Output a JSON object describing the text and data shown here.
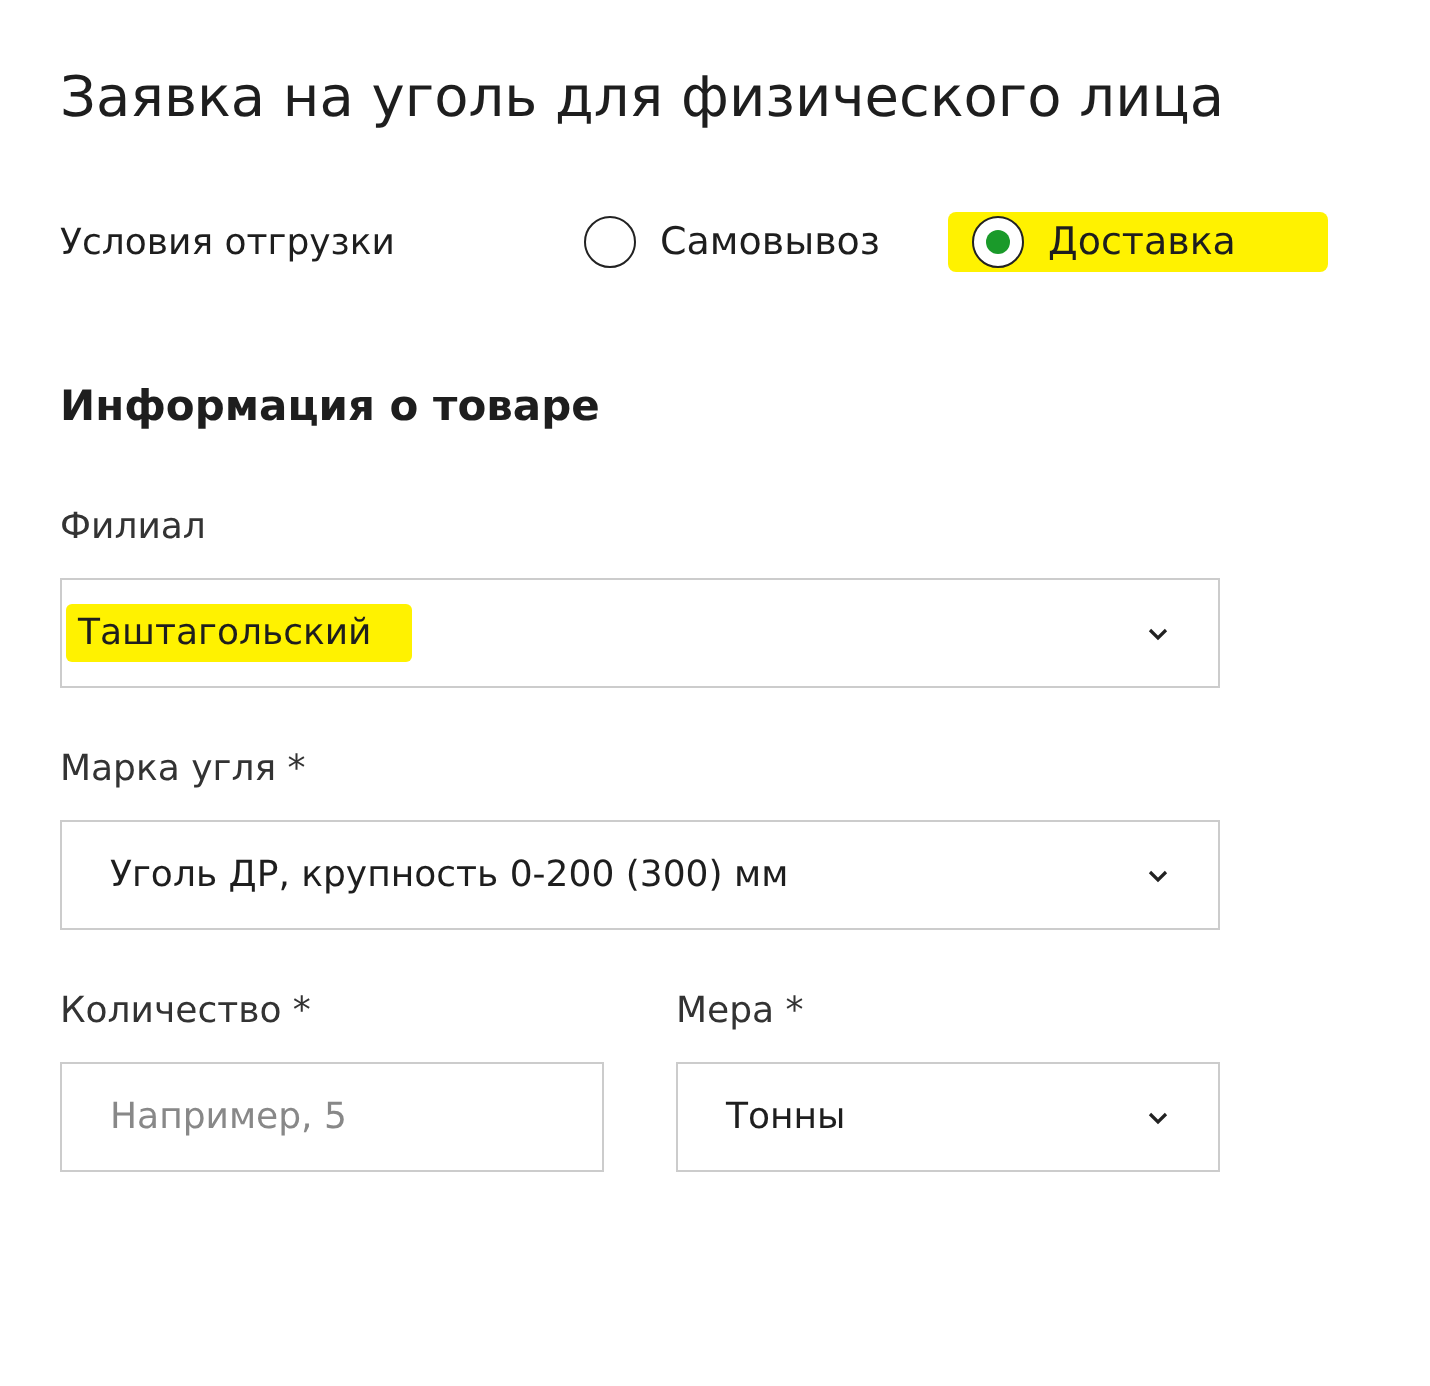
{
  "title": "Заявка на уголь для физического лица",
  "shipping": {
    "label": "Условия отгрузки",
    "options": [
      {
        "label": "Самовывоз",
        "selected": false,
        "highlighted": false
      },
      {
        "label": "Доставка",
        "selected": true,
        "highlighted": true
      }
    ]
  },
  "section_heading": "Информация о товаре",
  "fields": [
    {
      "kind": "select",
      "label": "Филиал",
      "value": "Таштагольский",
      "highlighted": true
    },
    {
      "kind": "select",
      "label": "Марка угля *",
      "value": "Уголь ДР, крупность 0-200 (300) мм",
      "highlighted": false
    }
  ],
  "row": [
    {
      "kind": "input",
      "label": "Количество *",
      "placeholder": "Например, 5"
    },
    {
      "kind": "select",
      "label": "Мера *",
      "value": "Тонны",
      "highlighted": false
    }
  ]
}
